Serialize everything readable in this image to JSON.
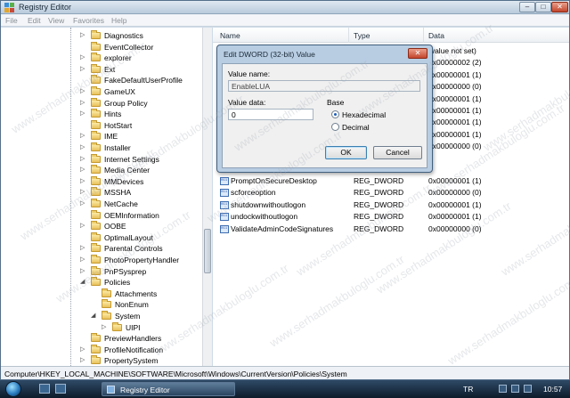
{
  "window": {
    "title": "Registry Editor",
    "controls": {
      "minimize": "–",
      "maximize": "□",
      "close": "✕"
    },
    "icons": {
      "app": "regedit-icon"
    }
  },
  "menu": [
    "File",
    "Edit",
    "View",
    "Favorites",
    "Help"
  ],
  "tree": [
    {
      "label": "Diagnostics",
      "expander": "▷"
    },
    {
      "label": "EventCollector",
      "expander": ""
    },
    {
      "label": "explorer",
      "expander": "▷"
    },
    {
      "label": "Ext",
      "expander": "▷"
    },
    {
      "label": "FakeDefaultUserProfile",
      "expander": ""
    },
    {
      "label": "GameUX",
      "expander": "▷"
    },
    {
      "label": "Group Policy",
      "expander": "▷"
    },
    {
      "label": "Hints",
      "expander": "▷"
    },
    {
      "label": "HotStart",
      "expander": ""
    },
    {
      "label": "IME",
      "expander": "▷"
    },
    {
      "label": "Installer",
      "expander": "▷"
    },
    {
      "label": "Internet Settings",
      "expander": "▷"
    },
    {
      "label": "Media Center",
      "expander": "▷"
    },
    {
      "label": "MMDevices",
      "expander": "▷"
    },
    {
      "label": "MSSHA",
      "expander": "▷"
    },
    {
      "label": "NetCache",
      "expander": "▷"
    },
    {
      "label": "OEMInformation",
      "expander": ""
    },
    {
      "label": "OOBE",
      "expander": "▷"
    },
    {
      "label": "OptimalLayout",
      "expander": ""
    },
    {
      "label": "Parental Controls",
      "expander": "▷"
    },
    {
      "label": "PhotoPropertyHandler",
      "expander": "▷"
    },
    {
      "label": "PnPSysprep",
      "expander": "▷"
    },
    {
      "label": "Policies",
      "expander": "◢"
    },
    {
      "label": "Attachments",
      "expander": ""
    },
    {
      "label": "NonEnum",
      "expander": ""
    },
    {
      "label": "System",
      "expander": "◢"
    },
    {
      "label": "UIPI",
      "expander": "▷"
    },
    {
      "label": "PreviewHandlers",
      "expander": ""
    },
    {
      "label": "ProfileNotification",
      "expander": "▷"
    },
    {
      "label": "PropertySystem",
      "expander": "▷"
    }
  ],
  "list": {
    "headers": {
      "name": "Name",
      "type": "Type",
      "data": "Data"
    },
    "hidden_rows": [
      {
        "data": "(value not set)"
      },
      {
        "data": "0x00000002 (2)"
      },
      {
        "data": "0x00000001 (1)"
      },
      {
        "data": "0x00000000 (0)"
      },
      {
        "data": "0x00000001 (1)"
      },
      {
        "data": "0x00000001 (1)"
      },
      {
        "data": "0x00000001 (1)"
      },
      {
        "data": "0x00000001 (1)"
      },
      {
        "data": "0x00000000 (0)"
      }
    ],
    "rows": [
      {
        "name": "PromptOnSecureDesktop",
        "type": "REG_DWORD",
        "data": "0x00000001 (1)"
      },
      {
        "name": "scforceoption",
        "type": "REG_DWORD",
        "data": "0x00000000 (0)"
      },
      {
        "name": "shutdownwithoutlogon",
        "type": "REG_DWORD",
        "data": "0x00000001 (1)"
      },
      {
        "name": "undockwithoutlogon",
        "type": "REG_DWORD",
        "data": "0x00000001 (1)"
      },
      {
        "name": "ValidateAdminCodeSignatures",
        "type": "REG_DWORD",
        "data": "0x00000000 (0)"
      }
    ],
    "partial_row": {
      "type": "REG_SZ"
    }
  },
  "dialog": {
    "title": "Edit DWORD (32-bit) Value",
    "close": "✕",
    "value_name_label": "Value name:",
    "value_name": "EnableLUA",
    "value_data_label": "Value data:",
    "value_data": "0",
    "base_label": "Base",
    "base_options": [
      "Hexadecimal",
      "Decimal"
    ],
    "base_selected": "Hexadecimal",
    "ok": "OK",
    "cancel": "Cancel"
  },
  "status": "Computer\\HKEY_LOCAL_MACHINE\\SOFTWARE\\Microsoft\\Windows\\CurrentVersion\\Policies\\System",
  "taskbar": {
    "task": "Registry Editor",
    "language": "TR",
    "clock": "10:57"
  },
  "watermark": "www.serhadmakbuloglu.com.tr"
}
